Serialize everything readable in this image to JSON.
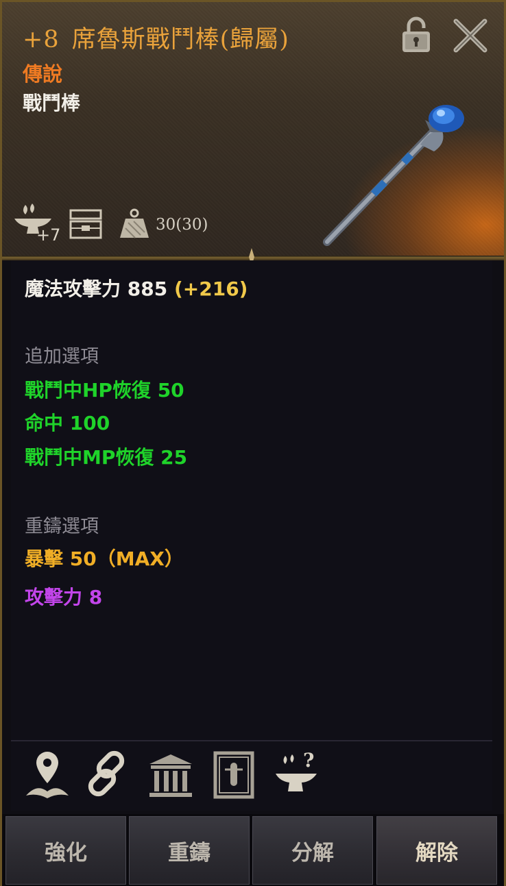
{
  "item": {
    "enhance": "+8",
    "name": "席魯斯戰鬥棒(歸屬)",
    "grade": "傳說",
    "category": "戰鬥棒",
    "enhance_limit": "+7",
    "weight": "30(30)"
  },
  "stats": {
    "main_label": "魔法攻擊力",
    "main_value": "885",
    "main_bonus": "(+216)"
  },
  "extra_options": {
    "title": "追加選項",
    "items": [
      "戰鬥中HP恢復 50",
      "命中 100",
      "戰鬥中MP恢復 25"
    ]
  },
  "reforge_options": {
    "title": "重鑄選項",
    "items": [
      {
        "text": "暴擊 50（MAX）",
        "color": "#f0ae26"
      },
      {
        "text": "攻擊力 8",
        "color": "#c245ea"
      }
    ]
  },
  "action_icons": [
    "location-pin-icon",
    "link-icon",
    "bank-icon",
    "codex-book-icon",
    "anvil-question-icon"
  ],
  "buttons": {
    "enhance": "強化",
    "reforge": "重鑄",
    "decompose": "分解",
    "release": "解除"
  },
  "colors": {
    "title": "#e9a23b",
    "grade_legendary": "#ee7a22",
    "option_green": "#1fd32a",
    "bonus_gold": "#f1c94a"
  }
}
